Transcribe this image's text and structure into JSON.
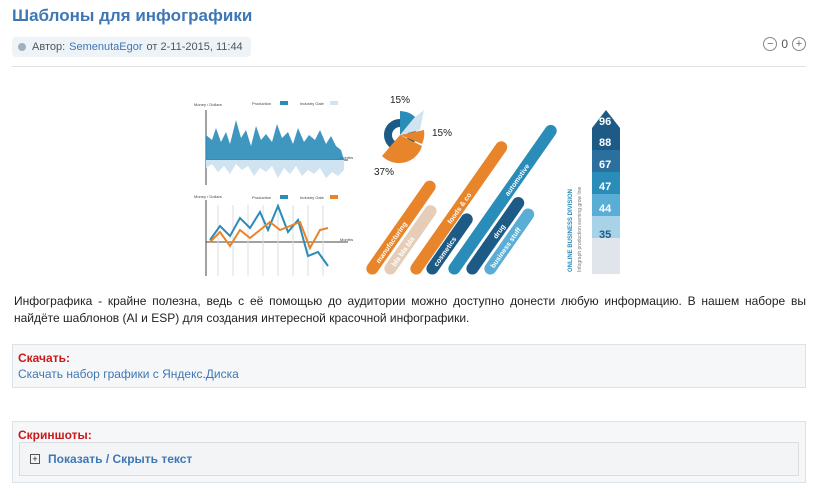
{
  "article": {
    "title": "Шаблоны для инфографики",
    "meta_prefix": "Автор:",
    "author": "SemenutaEgor",
    "date": "от 2-11-2015, 11:44",
    "rating_value": "0",
    "description": "Инфографика - крайне полезна, ведь с её помощью до аудитории можно доступно донести любую информацию. В нашем наборе вы найдёте шаблонов (AI и ESP) для создания интересной красочной инфографики."
  },
  "infographic": {
    "chart1_ylabel": "Money / Dollars",
    "chart1_legend1": "Production",
    "chart1_legend2": "Industry Gale",
    "chart1_xlabel": "Months",
    "chart2_ylabel": "Money / Dollars",
    "chart2_legend1": "Production",
    "chart2_legend2": "Industry Gale",
    "chart2_xlabel": "Months",
    "pie_top": "15%",
    "pie_right": "15%",
    "pie_bottom": "37%",
    "bars": [
      "manufacturing",
      "bla bla bla",
      "cosmetics",
      "foods & co",
      "automotive",
      "drug",
      "business stuff"
    ],
    "vert_text1": "ONLINE BUSINESS DIVISION",
    "vert_text2": "Infograph production earning grow line",
    "arrow_values": [
      "96",
      "88",
      "67",
      "47",
      "44",
      "35"
    ],
    "colors": {
      "orange": "#e8842a",
      "blue": "#2a8cb8",
      "navy": "#1d5b86",
      "light": "#cfe4f0"
    }
  },
  "download": {
    "title": "Скачать:",
    "link": "Скачать набор графики с Яндекс.Диска"
  },
  "screenshots": {
    "title": "Скриншоты:",
    "spoiler_icon": "plus-square-icon",
    "spoiler_label": "Показать / Скрыть текст"
  }
}
